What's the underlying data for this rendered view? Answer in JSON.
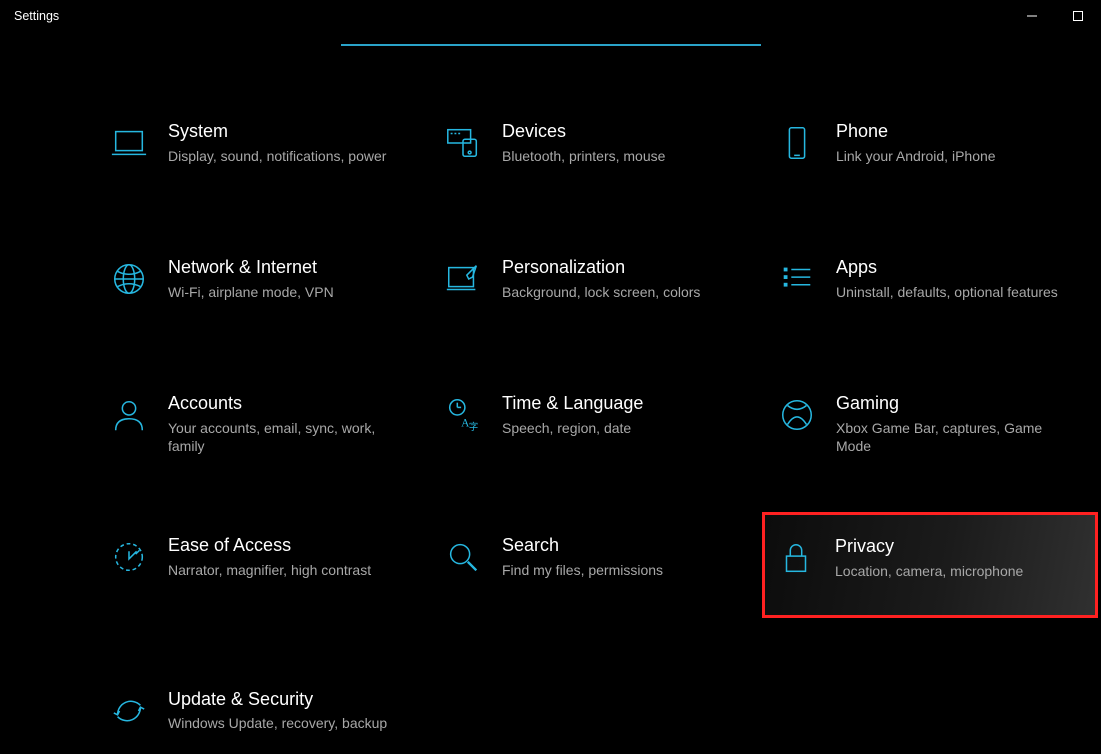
{
  "window": {
    "title": "Settings"
  },
  "accent_color": "#26b7e0",
  "highlight_color": "#ff2121",
  "categories": [
    {
      "id": "system",
      "icon": "laptop-icon",
      "title": "System",
      "desc": "Display, sound, notifications, power"
    },
    {
      "id": "devices",
      "icon": "devices-icon",
      "title": "Devices",
      "desc": "Bluetooth, printers, mouse"
    },
    {
      "id": "phone",
      "icon": "phone-icon",
      "title": "Phone",
      "desc": "Link your Android, iPhone"
    },
    {
      "id": "network",
      "icon": "globe-icon",
      "title": "Network & Internet",
      "desc": "Wi-Fi, airplane mode, VPN"
    },
    {
      "id": "personalization",
      "icon": "paintbrush-icon",
      "title": "Personalization",
      "desc": "Background, lock screen, colors"
    },
    {
      "id": "apps",
      "icon": "apps-list-icon",
      "title": "Apps",
      "desc": "Uninstall, defaults, optional features"
    },
    {
      "id": "accounts",
      "icon": "person-icon",
      "title": "Accounts",
      "desc": "Your accounts, email, sync, work, family"
    },
    {
      "id": "time-language",
      "icon": "time-lang-icon",
      "title": "Time & Language",
      "desc": "Speech, region, date"
    },
    {
      "id": "gaming",
      "icon": "xbox-icon",
      "title": "Gaming",
      "desc": "Xbox Game Bar, captures, Game Mode"
    },
    {
      "id": "ease-of-access",
      "icon": "ease-icon",
      "title": "Ease of Access",
      "desc": "Narrator, magnifier, high contrast"
    },
    {
      "id": "search",
      "icon": "search-icon",
      "title": "Search",
      "desc": "Find my files, permissions"
    },
    {
      "id": "privacy",
      "icon": "lock-icon",
      "title": "Privacy",
      "desc": "Location, camera, microphone",
      "highlighted": true
    },
    {
      "id": "update-security",
      "icon": "sync-icon",
      "title": "Update & Security",
      "desc": "Windows Update, recovery, backup"
    }
  ]
}
